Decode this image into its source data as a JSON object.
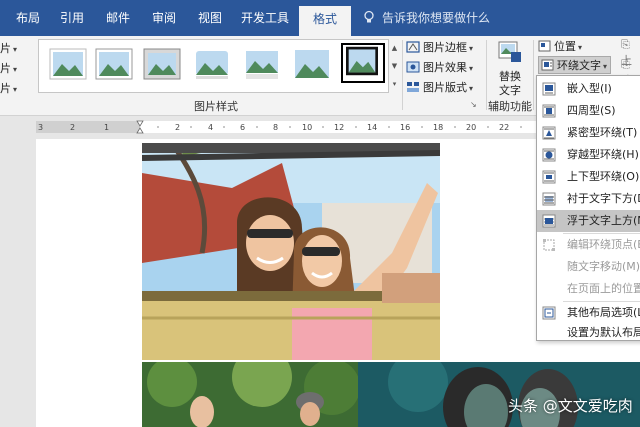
{
  "tabs": [
    {
      "label": "布局",
      "active": false
    },
    {
      "label": "引用",
      "active": false
    },
    {
      "label": "邮件",
      "active": false
    },
    {
      "label": "审阅",
      "active": false
    },
    {
      "label": "视图",
      "active": false
    },
    {
      "label": "开发工具",
      "active": false
    },
    {
      "label": "格式",
      "active": true
    }
  ],
  "tell_me": "告诉我你想要做什么",
  "ribbon": {
    "left_truncated": [
      "片",
      "片",
      "片"
    ],
    "picture_styles_label": "图片样式",
    "picture_border": "图片边框",
    "picture_effects": "图片效果",
    "picture_layout": "图片版式",
    "alt_text_line1": "替换",
    "alt_text_line2": "文字",
    "accessibility_label": "辅助功能",
    "position": "位置",
    "wrap_text": "环绕文字",
    "side_cut": "上",
    "side_cut2": "达"
  },
  "wrap_menu": {
    "items": [
      {
        "label": "嵌入型(I)",
        "icon": "inline-wrap-icon",
        "enabled": true,
        "highlighted": false
      },
      {
        "label": "四周型(S)",
        "icon": "square-wrap-icon",
        "enabled": true,
        "highlighted": false
      },
      {
        "label": "紧密型环绕(T)",
        "icon": "tight-wrap-icon",
        "enabled": true,
        "highlighted": false
      },
      {
        "label": "穿越型环绕(H)",
        "icon": "through-wrap-icon",
        "enabled": true,
        "highlighted": false
      },
      {
        "label": "上下型环绕(O)",
        "icon": "top-bottom-wrap-icon",
        "enabled": true,
        "highlighted": false
      },
      {
        "label": "衬于文字下方(D)",
        "icon": "behind-text-icon",
        "enabled": true,
        "highlighted": false
      },
      {
        "label": "浮于文字上方(N)",
        "icon": "in-front-of-text-icon",
        "enabled": true,
        "highlighted": true
      },
      {
        "label": "编辑环绕顶点(E)",
        "icon": "edit-wrap-points-icon",
        "enabled": false,
        "highlighted": false
      },
      {
        "label": "随文字移动(M)",
        "icon": "",
        "enabled": false,
        "highlighted": false
      },
      {
        "label": "在页面上的位置",
        "icon": "",
        "enabled": false,
        "highlighted": false
      },
      {
        "label": "其他布局选项(L)",
        "icon": "layout-options-icon",
        "enabled": true,
        "highlighted": false
      },
      {
        "label": "设置为默认布局",
        "icon": "",
        "enabled": true,
        "highlighted": false
      }
    ]
  },
  "watermark": "头条 @文文爱吃肉",
  "colors": {
    "ribbon_blue": "#2b579a",
    "highlight": "#c5c5c5"
  }
}
